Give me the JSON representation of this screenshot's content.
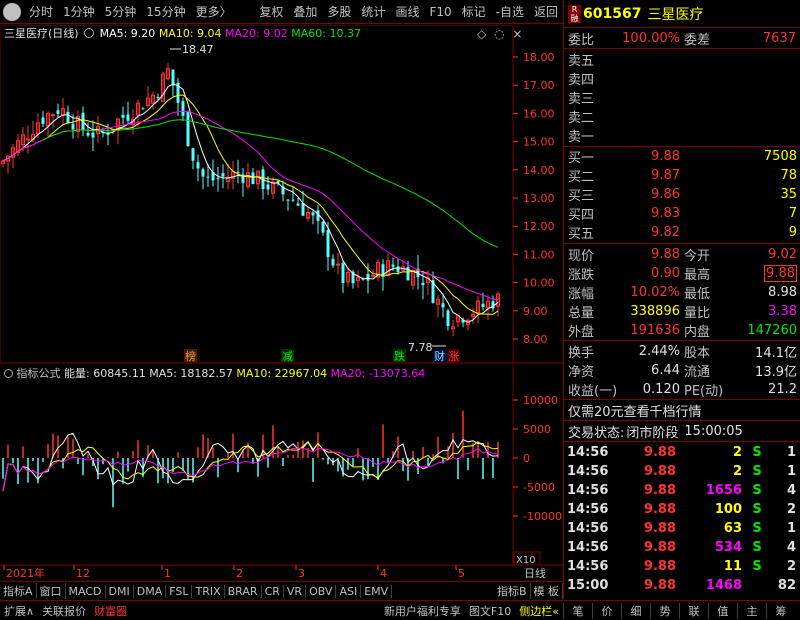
{
  "toolbar": {
    "left": [
      "分时",
      "1分钟",
      "5分钟",
      "15分钟",
      "更多〉"
    ],
    "right": [
      "复权",
      "叠加",
      "多股",
      "统计",
      "画线",
      "F10",
      "标记",
      "-自选",
      "返回"
    ]
  },
  "chart": {
    "stock_name": "三星医疗(日线)",
    "ma5": "MA5: 9.20",
    "ma10": "MA10: 9.04",
    "ma20": "MA20: 9.02",
    "ma60": "MA60: 10.37",
    "high_mark": "18.47",
    "low_mark": "7.78",
    "y_ticks": [
      "18.00",
      "17.00",
      "16.00",
      "15.00",
      "14.00",
      "13.00",
      "12.00",
      "11.00",
      "10.00",
      "9.00",
      "8.00"
    ],
    "tags": [
      "榜",
      "减",
      "跌",
      "财",
      "涨"
    ],
    "colors": {
      "up": "#ff3232",
      "down": "#54ffff",
      "ma5": "#ffffff",
      "ma10": "#ffff00",
      "ma20": "#ff00ff",
      "ma60": "#00e600"
    }
  },
  "indicator": {
    "label": "指标公式",
    "vol": "能量: 60845.11",
    "ma5": "MA5: 18182.57",
    "ma10": "MA10: 22967.04",
    "ma20": "MA20: -13073.64",
    "y_ticks": [
      "10000",
      "5000",
      "0",
      "-5000",
      "-10000"
    ],
    "scale": "X10"
  },
  "time_axis": {
    "labels": [
      "2021年",
      "12",
      "1",
      "2",
      "3",
      "4",
      "5"
    ],
    "period": "日线"
  },
  "indicator_tabs": [
    "指标A",
    "窗口",
    "MACD",
    "DMI",
    "DMA",
    "FSL",
    "TRIX",
    "BRAR",
    "CR",
    "VR",
    "OBV",
    "ASI",
    "EMV",
    "指标B",
    "模 板"
  ],
  "bottom_bar": {
    "left": [
      "扩展∧",
      "关联报价",
      "财富圈"
    ],
    "right": [
      "新用户福利专享",
      "图文F10",
      "侧边栏«"
    ]
  },
  "quote": {
    "code": "601567",
    "name": "三星医疗",
    "weibi_label": "委比",
    "weibi": "100.00%",
    "weicha_label": "委差",
    "weicha": "7637",
    "sell": [
      {
        "label": "卖五",
        "price": "",
        "vol": ""
      },
      {
        "label": "卖四",
        "price": "",
        "vol": ""
      },
      {
        "label": "卖三",
        "price": "",
        "vol": ""
      },
      {
        "label": "卖二",
        "price": "",
        "vol": ""
      },
      {
        "label": "卖一",
        "price": "",
        "vol": ""
      }
    ],
    "buy": [
      {
        "label": "买一",
        "price": "9.88",
        "vol": "7508"
      },
      {
        "label": "买二",
        "price": "9.87",
        "vol": "78"
      },
      {
        "label": "买三",
        "price": "9.86",
        "vol": "35"
      },
      {
        "label": "买四",
        "price": "9.83",
        "vol": "7"
      },
      {
        "label": "买五",
        "price": "9.82",
        "vol": "9"
      }
    ],
    "stats": [
      {
        "l1": "现价",
        "v1": "9.88",
        "c1": "red",
        "l2": "今开",
        "v2": "9.02",
        "c2": "red"
      },
      {
        "l1": "涨跌",
        "v1": "0.90",
        "c1": "red",
        "l2": "最高",
        "v2": "9.88",
        "c2": "red"
      },
      {
        "l1": "涨幅",
        "v1": "10.02%",
        "c1": "red",
        "l2": "最低",
        "v2": "8.98",
        "c2": "wht"
      },
      {
        "l1": "总量",
        "v1": "338896",
        "c1": "yel",
        "l2": "量比",
        "v2": "3.38",
        "c2": "mag"
      },
      {
        "l1": "外盘",
        "v1": "191636",
        "c1": "red",
        "l2": "内盘",
        "v2": "147260",
        "c2": "grn"
      }
    ],
    "stats2": [
      {
        "l1": "换手",
        "v1": "2.44%",
        "l2": "股本",
        "v2": "14.1亿"
      },
      {
        "l1": "净资",
        "v1": "6.44",
        "l2": "流通",
        "v2": "13.9亿"
      },
      {
        "l1": "收益(一)",
        "v1": "0.120",
        "l2": "PE(动)",
        "v2": "21.2"
      }
    ],
    "promo": "仅需20元查看千档行情",
    "status_label": "交易状态:",
    "status": "闭市阶段",
    "status_time": "15:00:05",
    "ticks": [
      {
        "t": "14:56",
        "p": "9.88",
        "v": "2",
        "s": "S",
        "n": "1",
        "vc": "yel"
      },
      {
        "t": "14:56",
        "p": "9.88",
        "v": "2",
        "s": "S",
        "n": "1",
        "vc": "yel"
      },
      {
        "t": "14:56",
        "p": "9.88",
        "v": "1656",
        "s": "S",
        "n": "4",
        "vc": "mag"
      },
      {
        "t": "14:56",
        "p": "9.88",
        "v": "100",
        "s": "S",
        "n": "2",
        "vc": "yel"
      },
      {
        "t": "14:56",
        "p": "9.88",
        "v": "63",
        "s": "S",
        "n": "1",
        "vc": "yel"
      },
      {
        "t": "14:56",
        "p": "9.88",
        "v": "534",
        "s": "S",
        "n": "4",
        "vc": "mag"
      },
      {
        "t": "14:56",
        "p": "9.88",
        "v": "11",
        "s": "S",
        "n": "2",
        "vc": "yel"
      },
      {
        "t": "15:00",
        "p": "9.88",
        "v": "1468",
        "s": "",
        "n": "82",
        "vc": "mag"
      }
    ],
    "tabs": [
      "笔",
      "价",
      "细",
      "势",
      "联",
      "值",
      "主",
      "筹"
    ]
  }
}
